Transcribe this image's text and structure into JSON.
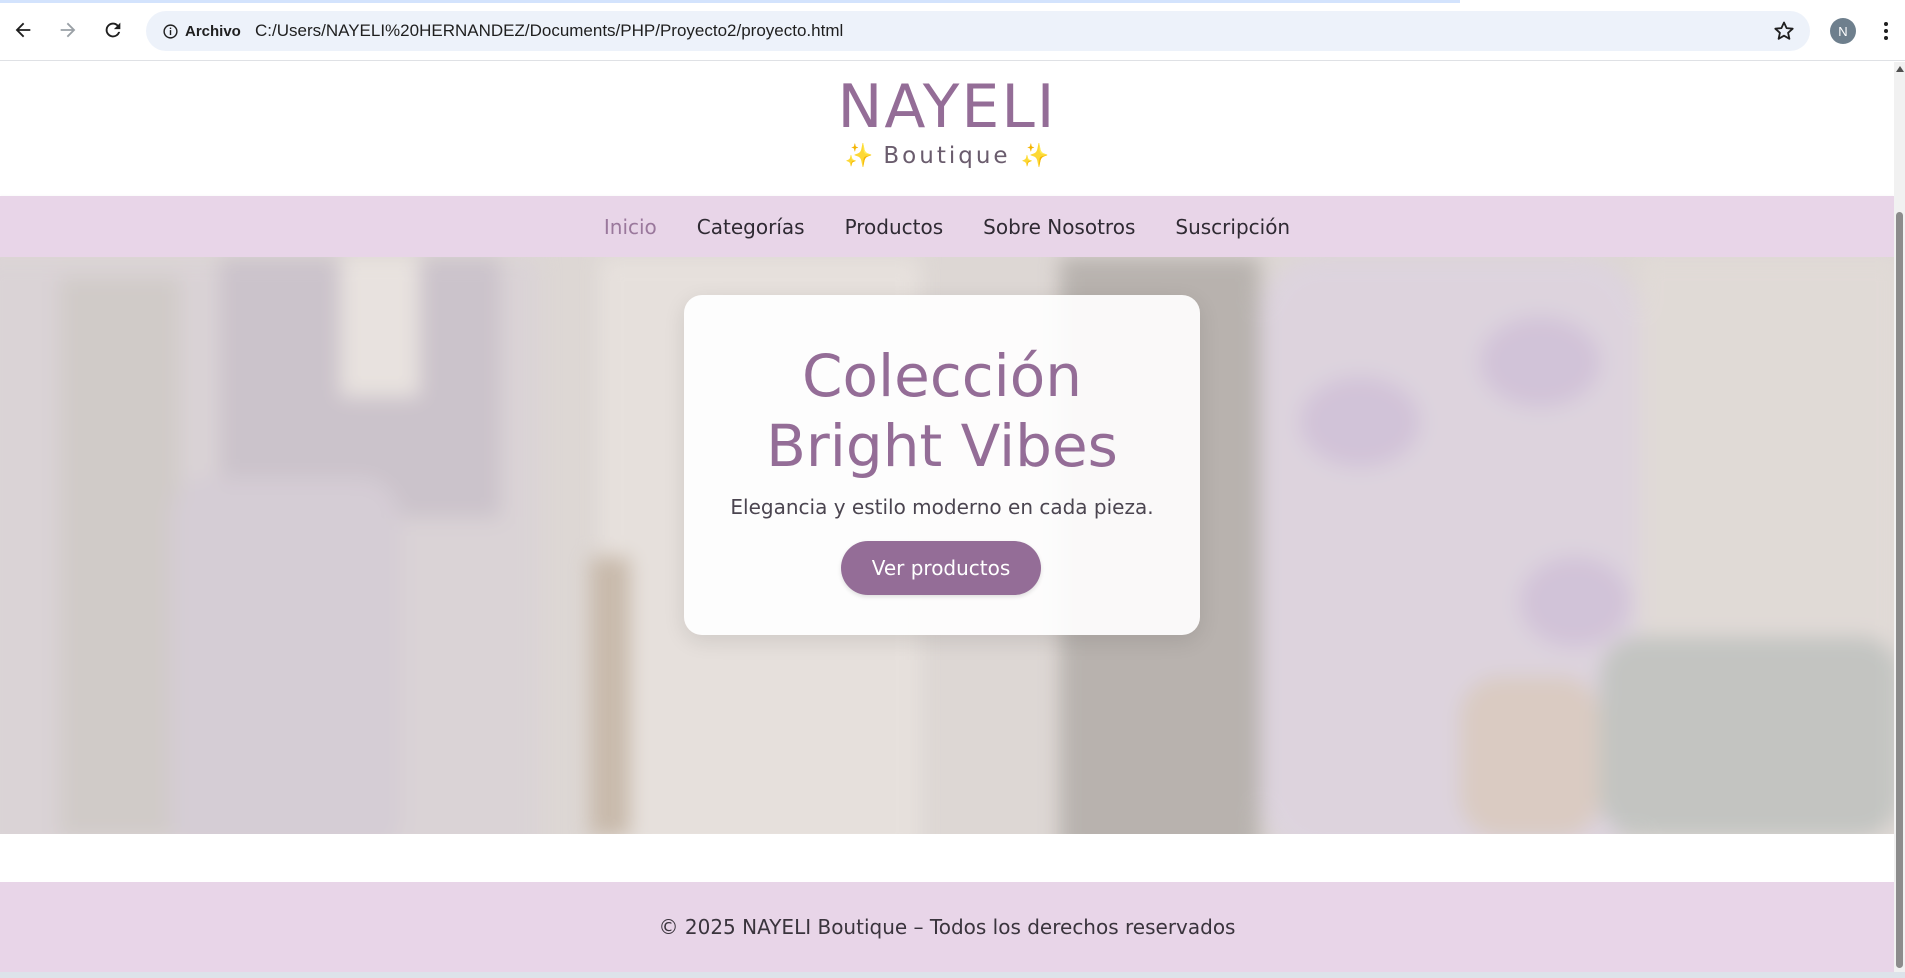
{
  "browser": {
    "site_chip_label": "Archivo",
    "url": "C:/Users/NAYELI%20HERNANDEZ/Documents/PHP/Proyecto2/proyecto.html",
    "profile_initial": "N"
  },
  "header": {
    "brand": "NAYELI",
    "tagline_sparkle_left": "✨",
    "tagline": "Boutique",
    "tagline_sparkle_right": "✨"
  },
  "nav": {
    "items": [
      {
        "label": "Inicio",
        "active": true
      },
      {
        "label": "Categorías",
        "active": false
      },
      {
        "label": "Productos",
        "active": false
      },
      {
        "label": "Sobre Nosotros",
        "active": false
      },
      {
        "label": "Suscripción",
        "active": false
      }
    ]
  },
  "hero": {
    "title_line1": "Colección",
    "title_line2": "Bright Vibes",
    "subtitle": "Elegancia y estilo moderno en cada pieza.",
    "button_label": "Ver productos"
  },
  "footer": {
    "text": "© 2025 NAYELI Boutique – Todos los derechos reservados"
  },
  "colors": {
    "brand": "#946d97",
    "nav_background": "#e8d5e8",
    "active_link": "#9a789c",
    "button": "#946d97"
  },
  "icons": {
    "back": "arrow-left-icon",
    "forward": "arrow-right-icon",
    "reload": "reload-icon",
    "site_info": "info-icon",
    "bookmark": "star-icon",
    "menu": "more-vert-icon"
  }
}
